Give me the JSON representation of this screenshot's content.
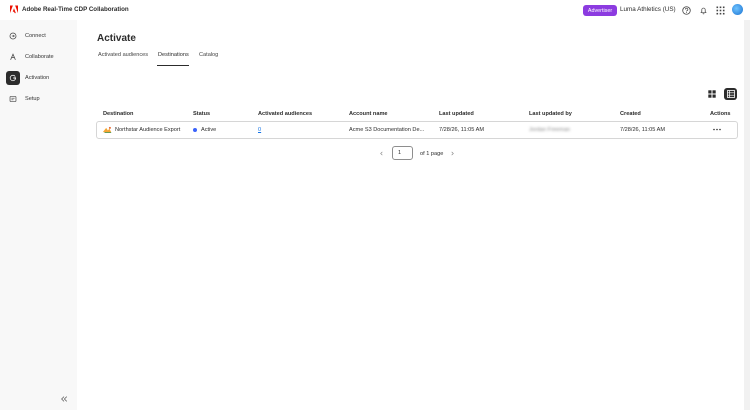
{
  "app": {
    "title": "Adobe Real-Time CDP Collaboration",
    "advertiser_label": "Advertiser",
    "org_name": "Luma Athletics (US)",
    "brand_color": "#eb1000",
    "accent_color": "#8c3be0"
  },
  "header_icons": [
    "help-icon",
    "bell-icon",
    "apps-grid-icon"
  ],
  "sidebar": {
    "items": [
      {
        "label": "Connect",
        "icon": "connect-icon",
        "active": false
      },
      {
        "label": "Collaborate",
        "icon": "collaborate-icon",
        "active": false
      },
      {
        "label": "Activation",
        "icon": "activation-icon",
        "active": true
      },
      {
        "label": "Setup",
        "icon": "setup-icon",
        "active": false
      }
    ]
  },
  "page": {
    "title": "Activate",
    "tabs": [
      {
        "label": "Activated audiences",
        "active": false
      },
      {
        "label": "Destinations",
        "active": true
      },
      {
        "label": "Catalog",
        "active": false
      }
    ]
  },
  "view_toggle": {
    "selected": "table"
  },
  "table": {
    "columns": [
      "Destination",
      "Status",
      "Activated audiences",
      "Account name",
      "Last updated",
      "Last updated by",
      "Created",
      "Actions"
    ],
    "rows": [
      {
        "destination": "Northstar Audience Export",
        "status": "Active",
        "activated_audiences": "0",
        "account_name": "Acme S3 Documentation De...",
        "last_updated": "7/28/26, 11:05 AM",
        "last_updated_by": "Jordan Freeman",
        "created": "7/28/26, 11:05 AM",
        "actions_icon": "more-icon"
      }
    ]
  },
  "pagination": {
    "current_page": "1",
    "of_label": "of 1 page"
  }
}
